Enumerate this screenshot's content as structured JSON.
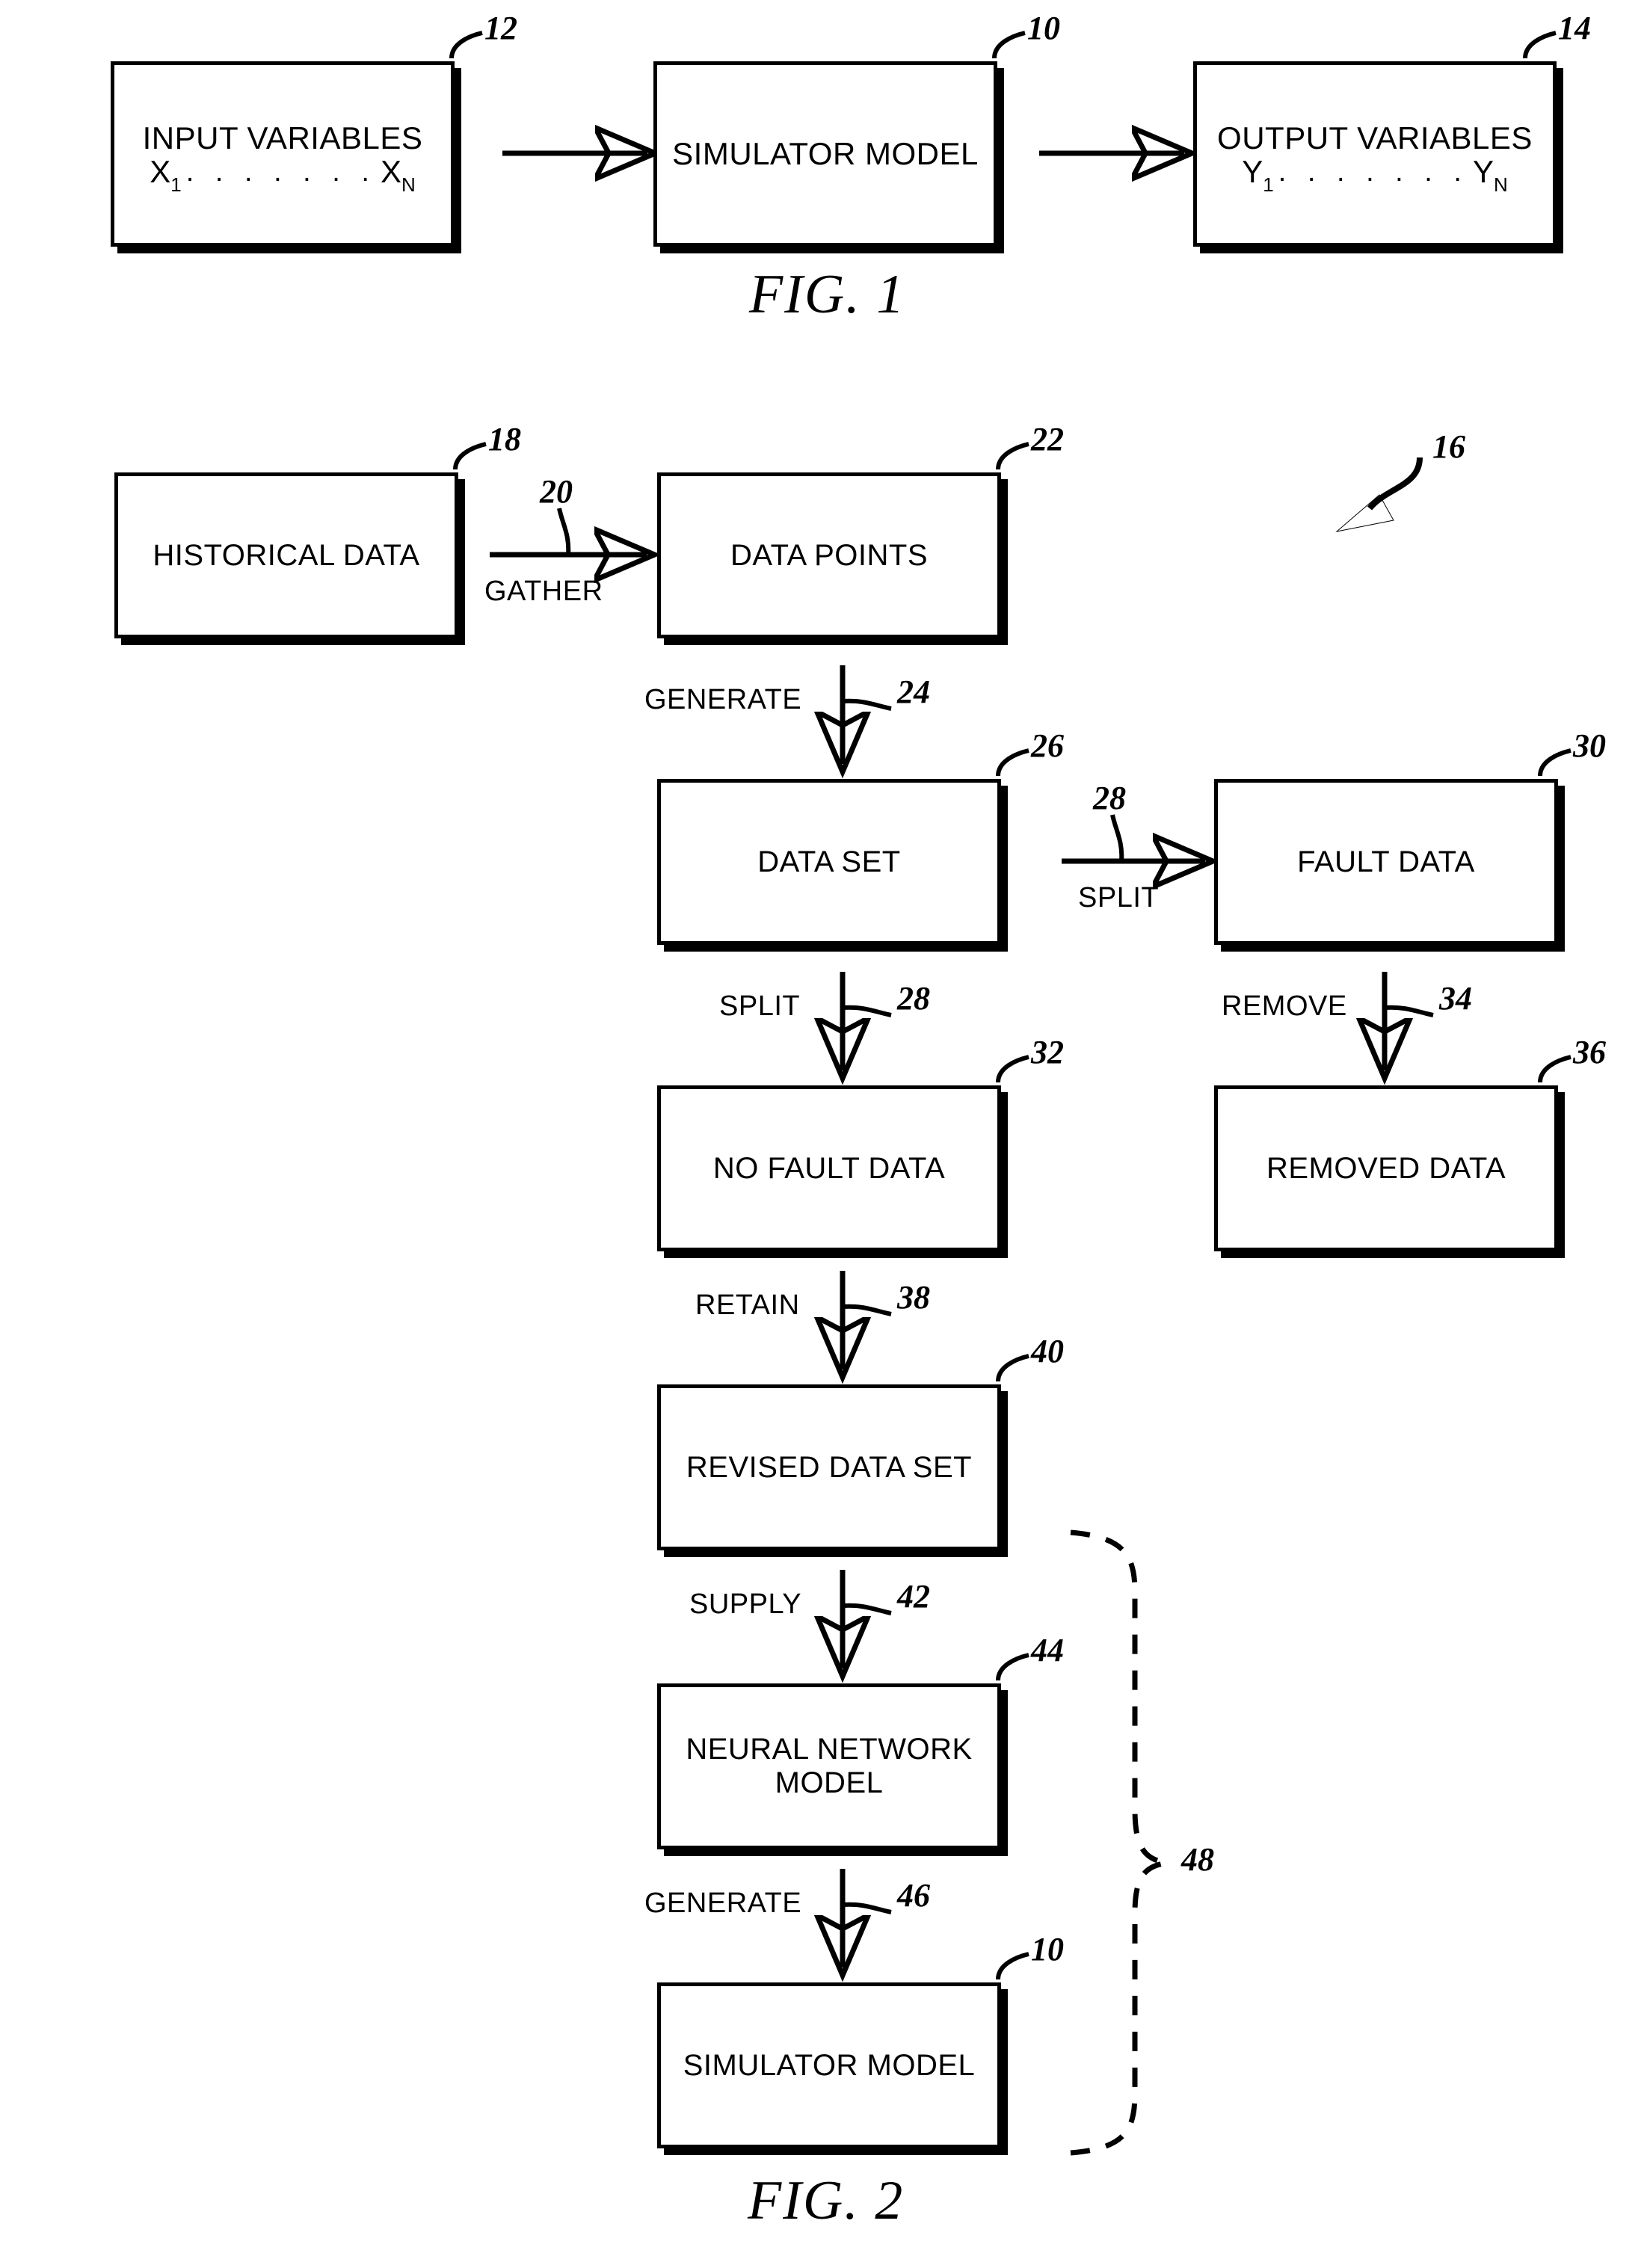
{
  "document": {
    "type": "patent-drawing-sheet",
    "figures": [
      "FIG. 1",
      "FIG. 2"
    ]
  },
  "fig1": {
    "caption": "FIG. 1",
    "boxes": [
      {
        "id": "input-variables",
        "label": "INPUT VARIABLES",
        "var_first": "X",
        "var_first_sub": "1",
        "var_dots": ". . . . . . .",
        "var_last": "X",
        "var_last_sub": "N",
        "ref": "12"
      },
      {
        "id": "simulator-model",
        "label": "SIMULATOR MODEL",
        "ref": "10"
      },
      {
        "id": "output-variables",
        "label": "OUTPUT VARIABLES",
        "var_first": "Y",
        "var_first_sub": "1",
        "var_dots": ". . . . . . .",
        "var_last": "Y",
        "var_last_sub": "N",
        "ref": "14"
      }
    ],
    "arrows": [
      {
        "id": "input-to-simulator",
        "label": ""
      },
      {
        "id": "simulator-to-output",
        "label": ""
      }
    ]
  },
  "fig2": {
    "caption": "FIG. 2",
    "system_ref": "16",
    "boxes": [
      {
        "id": "historical-data",
        "label": "HISTORICAL DATA",
        "ref": "18"
      },
      {
        "id": "data-points",
        "label": "DATA POINTS",
        "ref": "22"
      },
      {
        "id": "data-set",
        "label": "DATA SET",
        "ref": "26"
      },
      {
        "id": "fault-data",
        "label": "FAULT DATA",
        "ref": "30"
      },
      {
        "id": "no-fault-data",
        "label": "NO FAULT DATA",
        "ref": "32"
      },
      {
        "id": "removed-data",
        "label": "REMOVED DATA",
        "ref": "36"
      },
      {
        "id": "revised-data-set",
        "label": "REVISED DATA SET",
        "ref": "40"
      },
      {
        "id": "neural-network-model",
        "label_line1": "NEURAL NETWORK",
        "label_line2": "MODEL",
        "ref": "44"
      },
      {
        "id": "simulator-model",
        "label": "SIMULATOR MODEL",
        "ref": "10"
      }
    ],
    "steps": [
      {
        "id": "gather",
        "label": "GATHER",
        "ref": "20",
        "direction": "right"
      },
      {
        "id": "generate-24",
        "label": "GENERATE",
        "ref": "24",
        "direction": "down"
      },
      {
        "id": "split-28-h",
        "label": "SPLIT",
        "ref": "28",
        "direction": "right"
      },
      {
        "id": "split-28-v",
        "label": "SPLIT",
        "ref": "28",
        "direction": "down"
      },
      {
        "id": "remove-34",
        "label": "REMOVE",
        "ref": "34",
        "direction": "down"
      },
      {
        "id": "retain-38",
        "label": "RETAIN",
        "ref": "38",
        "direction": "down"
      },
      {
        "id": "supply-42",
        "label": "SUPPLY",
        "ref": "42",
        "direction": "down"
      },
      {
        "id": "generate-46",
        "label": "GENERATE",
        "ref": "46",
        "direction": "down"
      }
    ],
    "bracket": {
      "id": "model-bracket",
      "ref": "48"
    }
  },
  "colors": {
    "ink": "#000000",
    "paper": "#ffffff"
  }
}
